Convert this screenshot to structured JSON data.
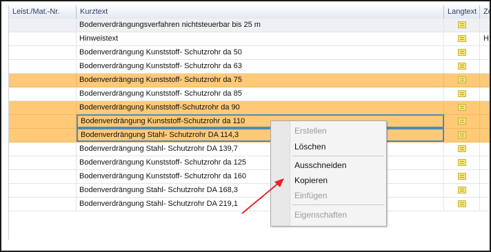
{
  "columns": [
    "Leist./Mat.-Nr.",
    "Kurztext",
    "Langtext",
    "Ze"
  ],
  "rows": [
    {
      "nr": "",
      "kurztext": "Bodenverdrängungsverfahren nichtsteuerbar bis 25 m",
      "langtext": true,
      "ze": "",
      "style": "grey"
    },
    {
      "nr": "",
      "kurztext": "Hinweistext",
      "langtext": true,
      "ze": "H",
      "style": "white"
    },
    {
      "nr": "",
      "kurztext": "Bodenverdrängung Kunststoff- Schutzrohr da 50",
      "langtext": true,
      "ze": "",
      "style": "white"
    },
    {
      "nr": "",
      "kurztext": "Bodenverdrängung Kunststoff- Schutzrohr da 63",
      "langtext": true,
      "ze": "",
      "style": "white"
    },
    {
      "nr": "",
      "kurztext": "Bodenverdrängung Kunststoff- Schutzrohr da 75",
      "langtext": true,
      "ze": "",
      "style": "orange"
    },
    {
      "nr": "",
      "kurztext": "Bodenverdrängung Kunststoff- Schutzrohr da 85",
      "langtext": true,
      "ze": "",
      "style": "white"
    },
    {
      "nr": "",
      "kurztext": "Bodenverdrängung Kunststoff-Schutzrohr da 90",
      "langtext": true,
      "ze": "",
      "style": "orange"
    },
    {
      "nr": "",
      "kurztext": "Bodenverdrängung Kunststoff-Schutzrohr da 110",
      "langtext": true,
      "ze": "",
      "style": "orange sel"
    },
    {
      "nr": "",
      "kurztext": "Bodenverdrängung Stahl- Schutzrohr DA 114,3",
      "langtext": true,
      "ze": "",
      "style": "orange sel"
    },
    {
      "nr": "",
      "kurztext": "Bodenverdrängung Stahl- Schutzrohr DA 139,7",
      "langtext": true,
      "ze": "",
      "style": "white"
    },
    {
      "nr": "",
      "kurztext": "Bodenverdrängung Kunststoff- Schutzrohr da 125",
      "langtext": true,
      "ze": "",
      "style": "white"
    },
    {
      "nr": "",
      "kurztext": "Bodenverdrängung Kunststoff- Schutzrohr da 160",
      "langtext": true,
      "ze": "",
      "style": "white"
    },
    {
      "nr": "",
      "kurztext": "Bodenverdrängung Stahl- Schutzrohr DA 168,3",
      "langtext": true,
      "ze": "",
      "style": "white"
    },
    {
      "nr": "",
      "kurztext": "Bodenverdrängung Stahl- Schutzrohr DA 219,1",
      "langtext": true,
      "ze": "",
      "style": "white"
    }
  ],
  "context_menu": {
    "items": [
      {
        "label": "Erstellen",
        "enabled": false
      },
      {
        "label": "Löschen",
        "enabled": true
      },
      {
        "label": "Ausschneiden",
        "enabled": true
      },
      {
        "label": "Kopieren",
        "enabled": true
      },
      {
        "label": "Einfügen",
        "enabled": false
      },
      {
        "label": "Eigenschaften",
        "enabled": false
      }
    ]
  },
  "colors": {
    "row_highlight": "#ffc977",
    "row_grey": "#eef0f3",
    "selection_border": "#4f8ab8",
    "annotation_highlight": "#ffff33",
    "annotation_arrow": "#e8202a"
  },
  "icons": {
    "langtext": "note-icon"
  }
}
